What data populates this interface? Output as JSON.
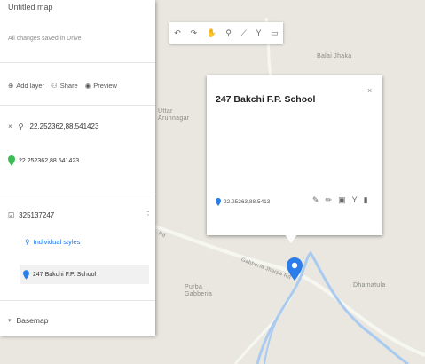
{
  "panel": {
    "title": "Untitled map",
    "saved_status": "All changes saved in Drive",
    "actions": {
      "add_layer": "Add layer",
      "share": "Share",
      "preview": "Preview"
    },
    "search": {
      "query": "22.252362,88.541423",
      "result": "22.252362,88.541423"
    },
    "layer": {
      "name": "325137247",
      "style_label": "Individual styles",
      "feature": "247 Bakchi F.P. School"
    },
    "basemap_label": "Basemap"
  },
  "map_labels": {
    "label1": "Balai Jhaka",
    "label2": "Uttar Arunnagar",
    "label3": "Purba Gabberia",
    "label4": "Dhamatula",
    "road1": "Gabberia Jharpa Rd",
    "road2": "Rd"
  },
  "popup": {
    "title": "247 Bakchi F.P. School",
    "coords": "22.25263,88.5413",
    "close_glyph": "×"
  },
  "colors": {
    "accent": "#1a73e8",
    "pin_blue": "#2b7de9",
    "pin_green": "#3cba54",
    "river": "#aacbf0"
  },
  "icons": {
    "map_tools": [
      "undo-icon",
      "redo-icon",
      "hand-icon",
      "marker-icon",
      "line-icon",
      "route-icon",
      "ruler-icon"
    ],
    "popup_actions": [
      "paint-icon",
      "edit-icon",
      "photo-icon",
      "directions-icon",
      "delete-icon"
    ]
  }
}
